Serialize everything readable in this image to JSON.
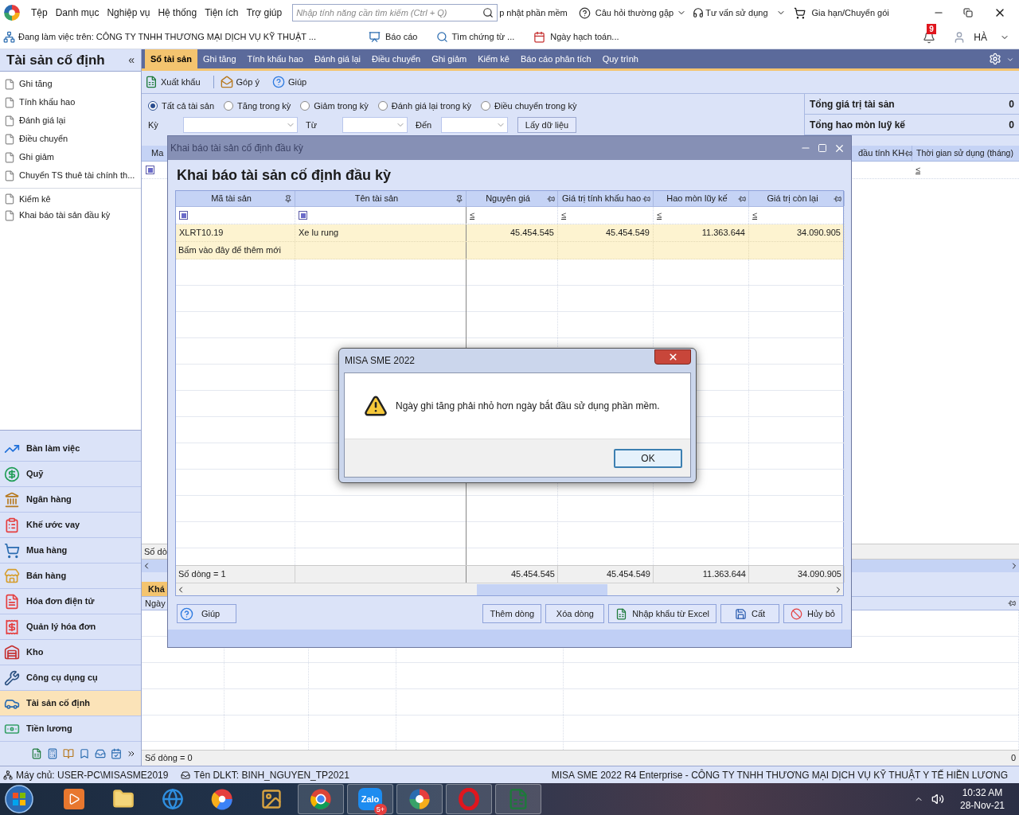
{
  "menu_bar": {
    "items": [
      "Tệp",
      "Danh mục",
      "Nghiệp vụ",
      "Hệ thống",
      "Tiện ích",
      "Trợ giúp"
    ],
    "search": {
      "placeholder": "Nhập tính năng cần tìm kiếm (Ctrl + Q)"
    },
    "update_link": "p nhật phần mềm",
    "faq": "Câu hỏi thường gặp",
    "support": "Tư vấn sử dụng",
    "renew": "Gia hạn/Chuyển gói"
  },
  "context_bar": {
    "company": "Đang làm việc trên: CÔNG TY TNHH THƯƠNG MẠI DỊCH VỤ KỸ THUẬT ...",
    "report": "Báo cáo",
    "find": "Tìm chứng từ ...",
    "date": "Ngày hạch toán...",
    "notifications": "9",
    "user": "HÀ"
  },
  "sidebar": {
    "title": "Tài sản cố định",
    "collapse": "«",
    "items": [
      {
        "label": "Ghi tăng"
      },
      {
        "label": "Tính khấu hao"
      },
      {
        "label": "Đánh giá lại"
      },
      {
        "label": "Điều chuyển"
      },
      {
        "label": "Ghi giảm"
      },
      {
        "label": "Chuyển TS thuê tài chính th..."
      },
      {
        "label": "Kiểm kê"
      },
      {
        "label": "Khai báo tài sản đầu kỳ"
      }
    ],
    "modules": [
      {
        "label": "Bàn làm việc",
        "kind": "dashboard",
        "selected": false
      },
      {
        "label": "Quỹ",
        "kind": "fund",
        "selected": false
      },
      {
        "label": "Ngân hàng",
        "kind": "bank",
        "selected": false
      },
      {
        "label": "Khế ước vay",
        "kind": "loan",
        "selected": false
      },
      {
        "label": "Mua hàng",
        "kind": "purchase",
        "selected": false
      },
      {
        "label": "Bán hàng",
        "kind": "sales",
        "selected": false
      },
      {
        "label": "Hóa đơn điện tử",
        "kind": "einvoice",
        "selected": false
      },
      {
        "label": "Quản lý hóa đơn",
        "kind": "invoice",
        "selected": false
      },
      {
        "label": "Kho",
        "kind": "warehouse",
        "selected": false
      },
      {
        "label": "Công cụ dụng cụ",
        "kind": "tools",
        "selected": false
      },
      {
        "label": "Tài sản cố định",
        "kind": "assets",
        "selected": true
      },
      {
        "label": "Tiền lương",
        "kind": "payroll",
        "selected": false
      }
    ]
  },
  "tabs": [
    {
      "label": "Sổ tài sản",
      "selected": true
    },
    {
      "label": "Ghi tăng",
      "selected": false
    },
    {
      "label": "Tính khấu hao",
      "selected": false
    },
    {
      "label": "Đánh giá lại",
      "selected": false
    },
    {
      "label": "Điều chuyển",
      "selected": false
    },
    {
      "label": "Ghi giảm",
      "selected": false
    },
    {
      "label": "Kiểm kê",
      "selected": false
    },
    {
      "label": "Báo cáo phân tích",
      "selected": false
    },
    {
      "label": "Quy trình",
      "selected": false
    }
  ],
  "toolbar": [
    {
      "label": "Xuất khẩu",
      "kind": "export"
    },
    {
      "label": "Góp ý",
      "kind": "feedback"
    },
    {
      "label": "Giúp",
      "kind": "help"
    }
  ],
  "filters": {
    "options": [
      {
        "label": "Tất cả tài sản",
        "selected": true
      },
      {
        "label": "Tăng trong kỳ",
        "selected": false
      },
      {
        "label": "Giảm trong kỳ",
        "selected": false
      },
      {
        "label": "Đánh giá lại trong kỳ",
        "selected": false
      },
      {
        "label": "Điều chuyển trong kỳ",
        "selected": false
      }
    ],
    "period_label": "Kỳ",
    "from_label": "Từ",
    "to_label": "Đến",
    "fetch_button": "Lấy dữ liệu"
  },
  "summary": [
    {
      "label": "Tổng giá trị tài sản",
      "value": "0"
    },
    {
      "label": "Tổng hao mòn luỹ kế",
      "value": "0"
    }
  ],
  "asset_grid": {
    "column_1": "Ma",
    "column_7": "đầu tính KH",
    "column_8": "Thời gian sử dụng (tháng)",
    "filter_symbol": "≤",
    "footer": "Số dò"
  },
  "detail_panel": {
    "tab": "Khá",
    "column_1": "Ngày",
    "footer": "Số dòng = 0",
    "total": "0"
  },
  "dialog": {
    "title": "Khai báo tài sản cố định đầu kỳ",
    "heading": "Khai báo tài sản cố định đầu kỳ",
    "columns": [
      "Mã tài sản",
      "Tên tài sản",
      "Nguyên giá",
      "Giá trị tính khấu hao",
      "Hao mòn lũy kế",
      "Giá trị còn lại"
    ],
    "filter_row": [
      {
        "kind": "checkbox"
      },
      {
        "kind": "checkbox"
      },
      {
        "kind": "compare",
        "text": "≤"
      },
      {
        "kind": "compare",
        "text": "≤"
      },
      {
        "kind": "compare",
        "text": "≤"
      },
      {
        "kind": "compare",
        "text": "≤"
      }
    ],
    "rows": [
      [
        "XLRT10.19",
        "Xe lu rung",
        "45.454.545",
        "45.454.549",
        "11.363.644",
        "34.090.905"
      ]
    ],
    "new_row_hint": "Bấm vào đây để thêm mới",
    "footer": {
      "count": "Số dòng = 1",
      "totals": [
        "45.454.545",
        "45.454.549",
        "11.363.644",
        "34.090.905"
      ]
    },
    "help_button": "Giúp",
    "buttons": [
      {
        "label": "Thêm dòng",
        "kind": "plain"
      },
      {
        "label": "Xóa dòng",
        "kind": "plain"
      },
      {
        "label": "Nhập khẩu từ Excel",
        "kind": "excel"
      },
      {
        "label": "Cất",
        "kind": "save"
      },
      {
        "label": "Hủy bỏ",
        "kind": "cancel"
      }
    ]
  },
  "message_box": {
    "title": "MISA SME 2022",
    "message": "Ngày ghi tăng phải nhỏ hơn ngày bắt đầu sử dụng phần mềm.",
    "ok": "OK"
  },
  "status_bar": {
    "server": "Máy chủ: USER-PC\\MISASME2019",
    "database": "Tên DLKT: BINH_NGUYEN_TP2021",
    "product": "MISA SME 2022 R4 Enterprise - CÔNG TY TNHH THƯƠNG MẠI DỊCH VỤ KỸ THUẬT Y TẾ HIỀN LƯƠNG"
  },
  "taskbar": {
    "apps": [
      {
        "kind": "player",
        "running": false
      },
      {
        "kind": "folder",
        "running": false
      },
      {
        "kind": "ie",
        "running": false
      },
      {
        "kind": "paint",
        "running": false
      },
      {
        "kind": "photos",
        "running": false
      },
      {
        "kind": "chrome",
        "running": true
      },
      {
        "kind": "zalo",
        "running": true,
        "label": "Zalo",
        "badge": "5+"
      },
      {
        "kind": "misa",
        "running": true
      },
      {
        "kind": "opera",
        "running": true
      },
      {
        "kind": "excel",
        "running": true
      }
    ],
    "time": "10:32 AM",
    "date": "28-Nov-21"
  }
}
